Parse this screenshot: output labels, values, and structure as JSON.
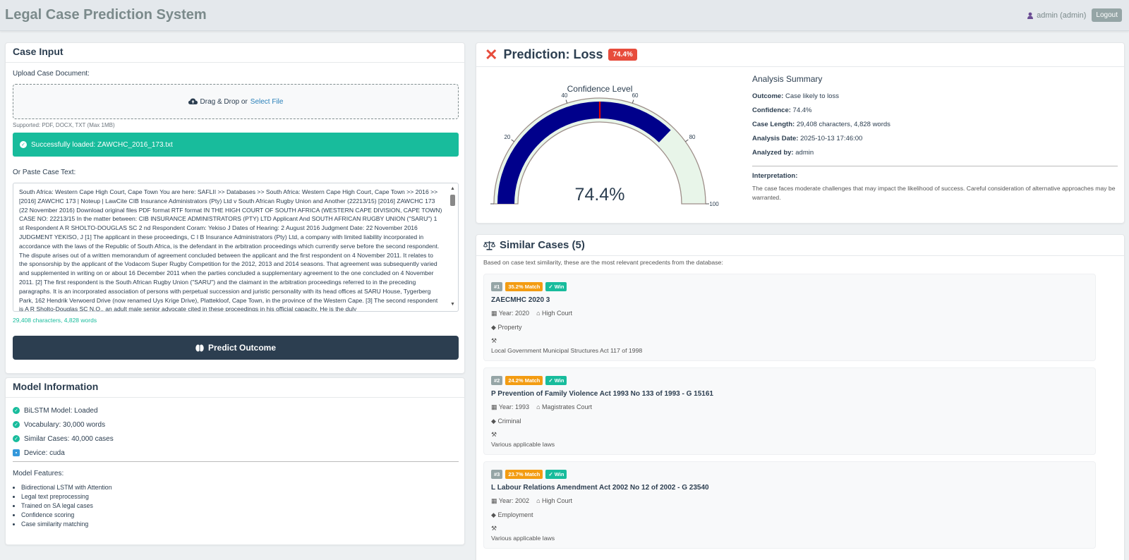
{
  "header": {
    "title": "Legal Case Prediction System",
    "user": "admin (admin)",
    "logout_label": "Logout"
  },
  "case_input": {
    "title": "Case Input",
    "upload_label": "Upload Case Document:",
    "dropzone_text": "Drag & Drop or",
    "select_file_label": "Select File",
    "supported_text": "Supported: PDF, DOCX, TXT (Max 1MB)",
    "success_text": "Successfully loaded: ZAWCHC_2016_173.txt",
    "paste_label": "Or Paste Case Text:",
    "case_text": "South Africa: Western Cape High Court, Cape Town You are here: SAFLII >> Databases >> South Africa: Western Cape High Court, Cape Town >> 2016 >> [2016] ZAWCHC 173 | Noteup | LawCite CIB Insurance Administrators (Pty) Ltd v South African Rugby Union and Another (22213/15) [2016] ZAWCHC 173 (22 November 2016) Download original files PDF format RTF format IN THE HIGH COURT OF SOUTH AFRICA (WESTERN CAPE DIVISION, CAPE TOWN) CASE NO: 22213/15 In the matter between: CIB INSURANCE ADMINISTRATORS (PTY) LTD Applicant And SOUTH AFRICAN RUGBY UNION (\"SARU\") 1 st Respondent A R SHOLTO-DOUGLAS SC 2 nd Respondent Coram: Yekiso J Dates of Hearing: 2 August 2016 Judgment Date: 22 November 2016 JUDGMENT YEKISO, J [1] The applicant in these proceedings, C I B Insurance Administrators (Pty) Ltd, a company with limited liability incorporated in accordance with the laws of the Republic of South Africa, is the defendant in the arbitration proceedings which currently serve before the second respondent. The dispute arises out of a written memorandum of agreement concluded between the applicant and the first respondent on 4 November 2011. It relates to the sponsorship by the applicant of the Vodacom Super Rugby Competition for the 2012, 2013 and 2014 seasons. That agreement was subsequently varied and supplemented in writing on or about 16 December 2011 when the parties concluded a supplementary agreement to the one concluded on 4 November 2011. [2] The first respondent is the South African Rugby Union (\"SARU\") and the claimant in the arbitration proceedings referred to in the preceding paragraphs. It is an incorporated association of persons with perpetual succession and juristic personality with its head offices at SARU House, Tygerberg Park, 162 Hendrik Verwoerd Drive (now renamed Uys Krige Drive), Plattekloof, Cape Town, in the province of the Western Cape. [3] The second respondent is A R Sholto-Douglas SC N.O., an adult male senior advocate cited in these proceedings in his official capacity. He is the duly",
    "char_count": "29,408 characters, 4,828 words",
    "predict_label": "Predict Outcome"
  },
  "model_info": {
    "title": "Model Information",
    "items": [
      {
        "icon": "check-circle-icon",
        "text": "BiLSTM Model: Loaded"
      },
      {
        "icon": "check-circle-icon",
        "text": "Vocabulary: 30,000 words"
      },
      {
        "icon": "check-circle-icon",
        "text": "Similar Cases: 40,000 cases"
      },
      {
        "icon": "chip-icon",
        "text": "Device: cuda"
      }
    ],
    "features_title": "Model Features:",
    "features": [
      "Bidirectional LSTM with Attention",
      "Legal text preprocessing",
      "Trained on SA legal cases",
      "Confidence scoring",
      "Case similarity matching"
    ]
  },
  "prediction": {
    "title": "Prediction: Loss",
    "badge": "74.4%",
    "gauge": {
      "title": "Confidence Level",
      "value": 74.4,
      "value_text": "74.4%",
      "threshold": 50,
      "range": [
        0,
        100
      ],
      "ticks": [
        "0",
        "20",
        "40",
        "60",
        "80",
        "100"
      ],
      "bar_color": "#00008b",
      "remaining_color": "#e8f5e9",
      "threshold_color": "#e00000"
    },
    "summary": {
      "title": "Analysis Summary",
      "outcome_label": "Outcome:",
      "outcome": "Case likely to loss",
      "confidence_label": "Confidence:",
      "confidence": "74.4%",
      "length_label": "Case Length:",
      "length": "29,408 characters, 4,828 words",
      "date_label": "Analysis Date:",
      "date": "2025-10-13 17:46:00",
      "by_label": "Analyzed by:",
      "by": "admin",
      "interp_label": "Interpretation:",
      "interp_text": "The case faces moderate challenges that may impact the likelihood of success. Careful consideration of alternative approaches may be warranted."
    }
  },
  "similar": {
    "title": "Similar Cases (5)",
    "intro": "Based on case text similarity, these are the most relevant precedents from the database:",
    "cases": [
      {
        "rank": "#1",
        "match": "35.2% Match",
        "outcome": "Win",
        "title": "ZAECMHC 2020 3",
        "year": "Year: 2020",
        "court": "High Court",
        "category": "Property",
        "law": "Local Government Municipal Structures Act 117 of 1998"
      },
      {
        "rank": "#2",
        "match": "24.2% Match",
        "outcome": "Win",
        "title": "P Prevention of Family Violence Act 1993 No 133 of 1993 - G 15161",
        "year": "Year: 1993",
        "court": "Magistrates Court",
        "category": "Criminal",
        "law": "Various applicable laws"
      },
      {
        "rank": "#3",
        "match": "23.7% Match",
        "outcome": "Win",
        "title": "L Labour Relations Amendment Act 2002 No 12 of 2002 - G 23540",
        "year": "Year: 2002",
        "court": "High Court",
        "category": "Employment",
        "law": "Various applicable laws"
      }
    ]
  },
  "colors": {
    "primary": "#2c3e50",
    "success": "#18bc9c",
    "danger": "#e74c3c",
    "warning": "#f39c12",
    "link": "#2980b9"
  }
}
